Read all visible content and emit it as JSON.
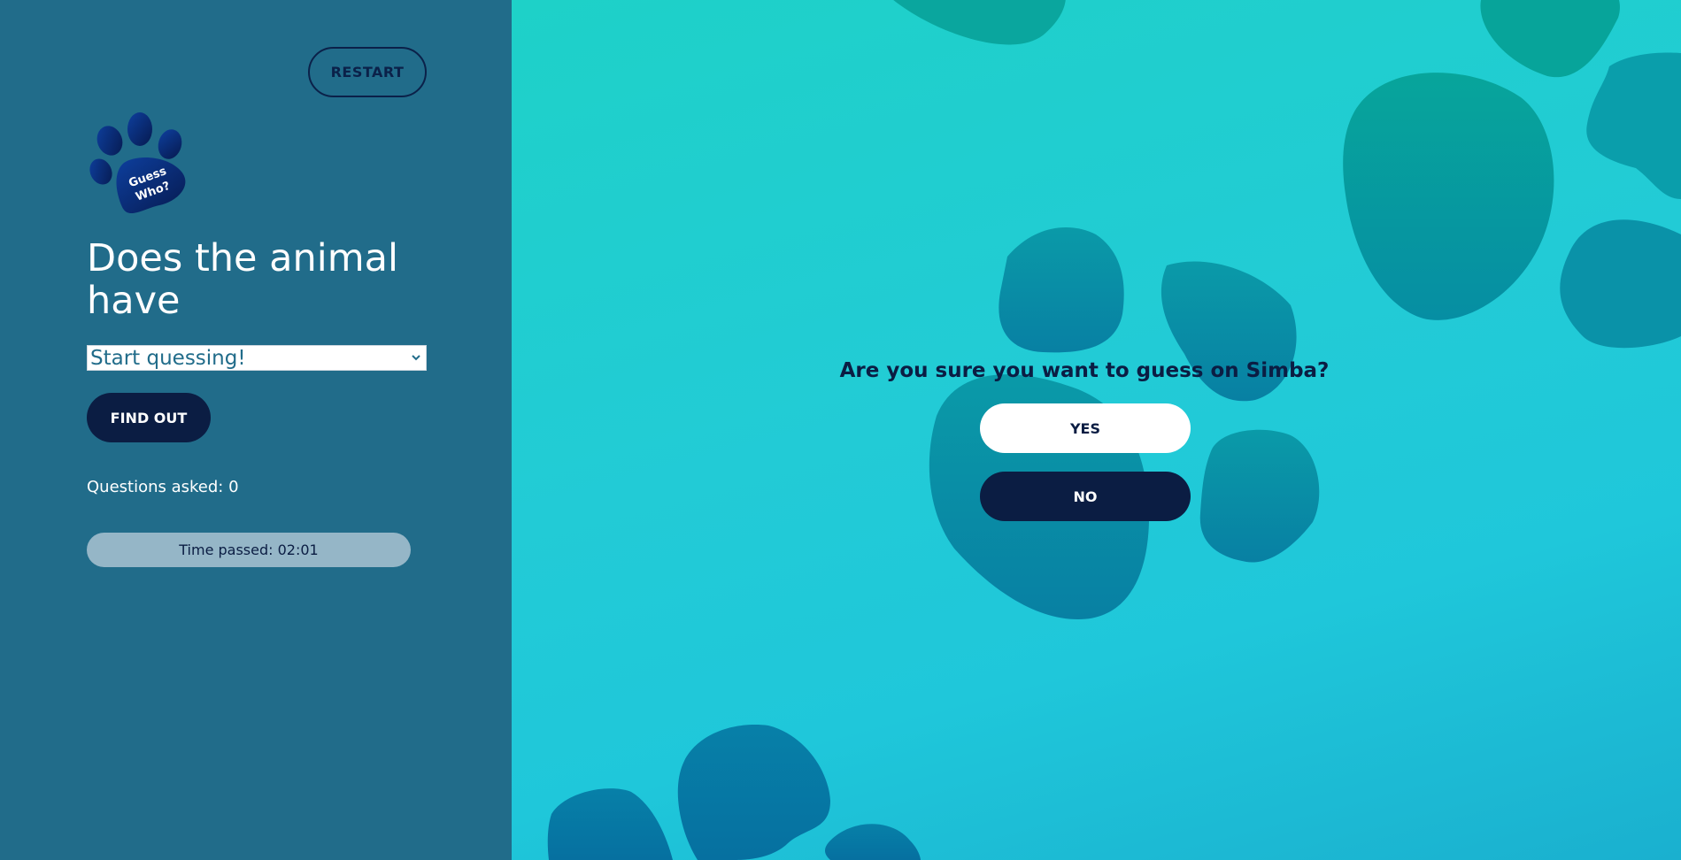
{
  "sidebar": {
    "restart_label": "RESTART",
    "logo": {
      "icon": "paw-icon",
      "line1": "Guess",
      "line2": "Who?"
    },
    "question_title": "Does the animal have",
    "select": {
      "selected": "Start quessing!",
      "icon": "chevron-down-icon"
    },
    "find_out_label": "FIND OUT",
    "questions_asked": "Questions asked: 0",
    "time_passed": "Time passed: 02:01"
  },
  "confirm": {
    "question": "Are you sure you want to guess on Simba?",
    "yes_label": "YES",
    "no_label": "NO"
  },
  "colors": {
    "sidebar_bg": "#216c8a",
    "dark_navy": "#0b1d43",
    "main_bg": "#22cbd6",
    "paw_shape": "#0a8fa6",
    "timer_bg": "#95b6c7"
  }
}
